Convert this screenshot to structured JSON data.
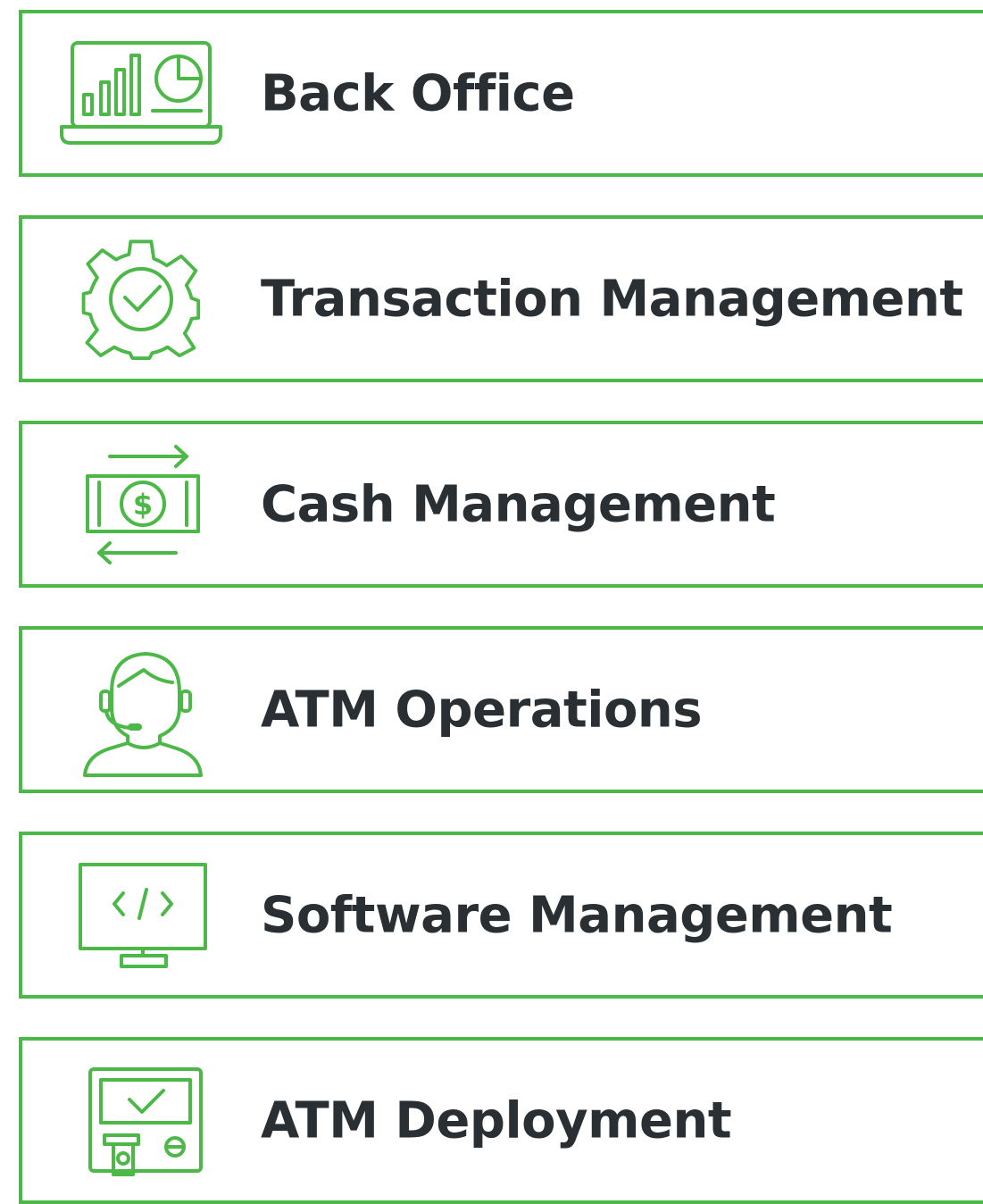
{
  "accent_color": "#4cb848",
  "text_color": "#2a2f33",
  "items": [
    {
      "label": "Back Office",
      "icon": "laptop-chart-icon"
    },
    {
      "label": "Transaction Management",
      "icon": "gear-check-icon"
    },
    {
      "label": "Cash Management",
      "icon": "cash-exchange-icon"
    },
    {
      "label": "ATM Operations",
      "icon": "support-agent-icon"
    },
    {
      "label": "Software Management",
      "icon": "monitor-code-icon"
    },
    {
      "label": "ATM Deployment",
      "icon": "atm-machine-icon"
    }
  ]
}
